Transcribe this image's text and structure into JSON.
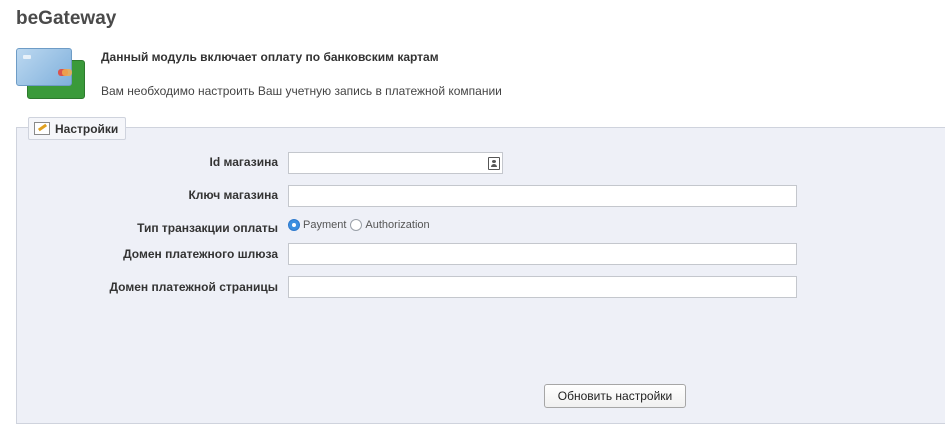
{
  "app": {
    "title": "beGateway"
  },
  "info": {
    "heading": "Данный модуль включает оплату по банковским картам",
    "subtext": "Вам необходимо настроить Ваш учетную запись в платежной компании"
  },
  "settings": {
    "legend": "Настройки",
    "fields": {
      "shop_id": {
        "label": "Id магазина",
        "value": ""
      },
      "shop_key": {
        "label": "Ключ магазина",
        "value": ""
      },
      "transaction_type": {
        "label": "Тип транзакции оплаты",
        "options": [
          "Payment",
          "Authorization"
        ],
        "selected": "Payment"
      },
      "gateway_domain": {
        "label": "Домен платежного шлюза",
        "value": ""
      },
      "checkout_domain": {
        "label": "Домен платежной страницы",
        "value": ""
      }
    },
    "submit_label": "Обновить настройки"
  },
  "icons": {
    "module": "credit-cards-icon",
    "legend": "edit-icon",
    "field": "contact-card-icon"
  },
  "colors": {
    "panel_bg": "#eef0f7",
    "radio_checked": "#3b8fe0"
  }
}
